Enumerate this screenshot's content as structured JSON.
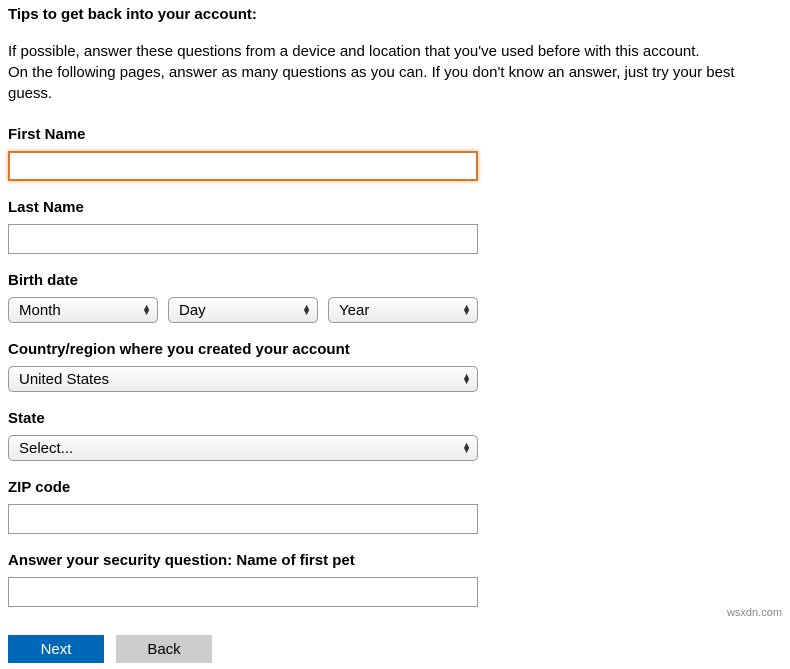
{
  "title": "Tips to get back into your account:",
  "tips_line1": "If possible, answer these questions from a device and location that you've used before with this account.",
  "tips_line2": "On the following pages, answer as many questions as you can. If you don't know an answer, just try your best guess.",
  "labels": {
    "first_name": "First Name",
    "last_name": "Last Name",
    "birth_date": "Birth date",
    "country": "Country/region where you created your account",
    "state": "State",
    "zip": "ZIP code",
    "security": "Answer your security question: Name of first pet"
  },
  "values": {
    "first_name": "",
    "last_name": "",
    "month": "Month",
    "day": "Day",
    "year": "Year",
    "country": "United States",
    "state": "Select...",
    "zip": "",
    "security": ""
  },
  "buttons": {
    "next": "Next",
    "back": "Back"
  },
  "watermark": "wsxdn.com"
}
